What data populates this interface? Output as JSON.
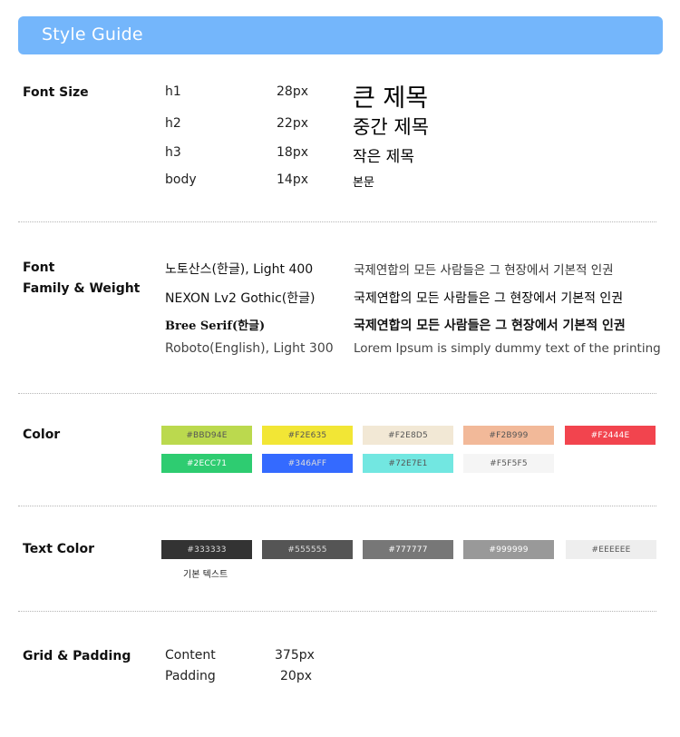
{
  "header": {
    "title": "Style Guide",
    "color": "#74B6FB"
  },
  "font_size": {
    "label": "Font Size",
    "rows": [
      {
        "tag": "h1",
        "size": "28px",
        "sample": "큰 제목"
      },
      {
        "tag": "h2",
        "size": "22px",
        "sample": "중간 제목"
      },
      {
        "tag": "h3",
        "size": "18px",
        "sample": "작은 제목"
      },
      {
        "tag": "body",
        "size": "14px",
        "sample": "본문"
      }
    ]
  },
  "font_family": {
    "label_line1": "Font",
    "label_line2": "Family & Weight",
    "rows": [
      {
        "name": "노토산스(한글), Light 400",
        "sample": "국제연합의 모든 사람들은 그 현장에서 기본적 인권"
      },
      {
        "name": "NEXON Lv2 Gothic(한글)",
        "sample": "국제연합의 모든 사람들은 그 현장에서 기본적 인권"
      },
      {
        "name": "Bree Serif(한글)",
        "sample": "국제연합의 모든 사람들은 그 현장에서 기본적 인권"
      },
      {
        "name": "Roboto(English), Light 300",
        "sample": "Lorem Ipsum is simply dummy text of the printing"
      }
    ]
  },
  "color": {
    "label": "Color",
    "swatches": [
      {
        "hex": "#BBD94E",
        "label": "#BBD94E"
      },
      {
        "hex": "#F2E635",
        "label": "#F2E635"
      },
      {
        "hex": "#F2E8D5",
        "label": "#F2E8D5"
      },
      {
        "hex": "#F2B999",
        "label": "#F2B999"
      },
      {
        "hex": "#F2444E",
        "label": "#F2444E"
      },
      {
        "hex": "#2ECC71",
        "label": "#2ECC71"
      },
      {
        "hex": "#346AFF",
        "label": "#346AFF"
      },
      {
        "hex": "#72E7E1",
        "label": "#72E7E1"
      },
      {
        "hex": "#F5F5F5",
        "label": "#F5F5F5"
      }
    ]
  },
  "text_color": {
    "label": "Text Color",
    "swatches": [
      {
        "hex": "#333333",
        "label": "#333333"
      },
      {
        "hex": "#555555",
        "label": "#555555"
      },
      {
        "hex": "#777777",
        "label": "#777777"
      },
      {
        "hex": "#999999",
        "label": "#999999"
      },
      {
        "hex": "#EEEEEE",
        "label": "#EEEEEE"
      }
    ],
    "caption": "기본 텍스트"
  },
  "grid": {
    "label": "Grid & Padding",
    "content_label": "Content",
    "content_value": "375px",
    "padding_label": "Padding",
    "padding_value": "20px"
  }
}
